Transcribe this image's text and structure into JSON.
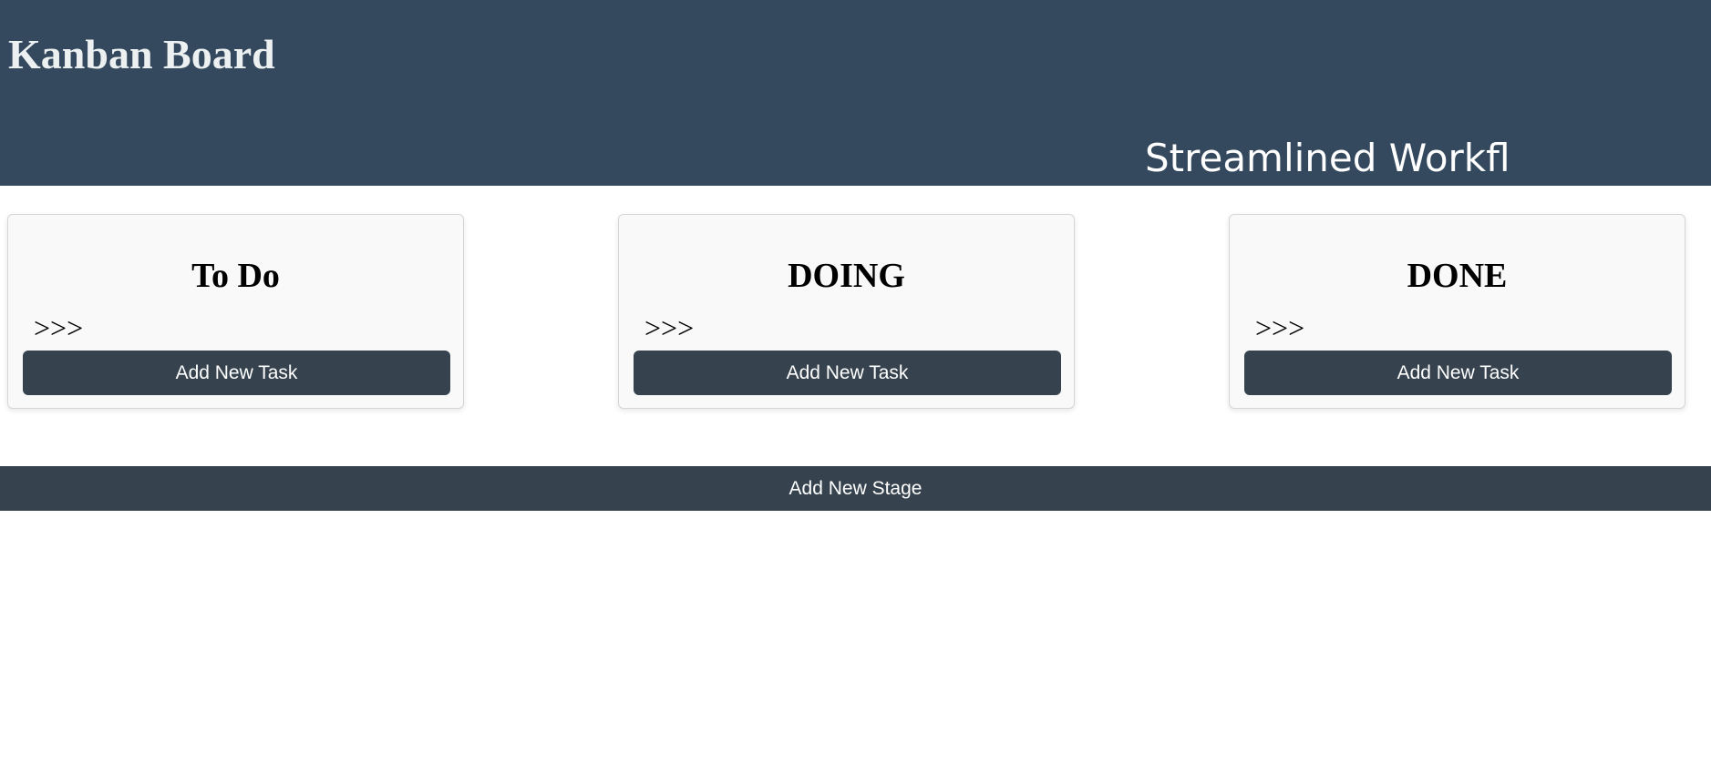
{
  "header": {
    "title": "Kanban Board",
    "tagline": "Streamlined Workfl"
  },
  "stages": [
    {
      "title": "To Do",
      "arrows": ">>>",
      "add_task_label": "Add New Task"
    },
    {
      "title": "DOING",
      "arrows": ">>>",
      "add_task_label": "Add New Task"
    },
    {
      "title": "DONE",
      "arrows": ">>>",
      "add_task_label": "Add New Task"
    }
  ],
  "add_stage_label": "Add New Stage",
  "colors": {
    "header_bg": "#34495e",
    "button_bg": "#36434f",
    "card_bg": "#f9f9f9"
  }
}
